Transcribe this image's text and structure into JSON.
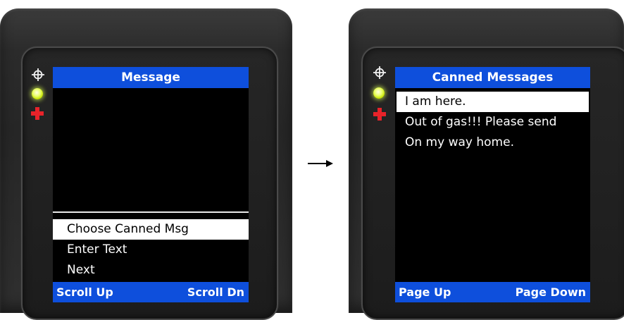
{
  "left_screen": {
    "title": "Message",
    "menu": [
      {
        "label": "Choose Canned Msg",
        "selected": true
      },
      {
        "label": "Enter Text",
        "selected": false
      },
      {
        "label": "Next",
        "selected": false
      }
    ],
    "softkey_left": "Scroll Up",
    "softkey_right": "Scroll Dn"
  },
  "right_screen": {
    "title": "Canned Messages",
    "messages": [
      {
        "label": "I am here.",
        "selected": true
      },
      {
        "label": "Out of gas!!! Please send",
        "selected": false
      },
      {
        "label": "On my way home.",
        "selected": false
      }
    ],
    "softkey_left": "Page Up",
    "softkey_right": "Page Down"
  },
  "indicators": [
    "target-icon",
    "yellow-led",
    "red-plus-icon"
  ],
  "colors": {
    "title_bar": "#0e4fdc",
    "screen_bg": "#000000",
    "selection_bg": "#ffffff",
    "led_yellow": "#eaff6a",
    "plus_red": "#e8232a"
  },
  "transition_arrow": "right-arrow-icon"
}
